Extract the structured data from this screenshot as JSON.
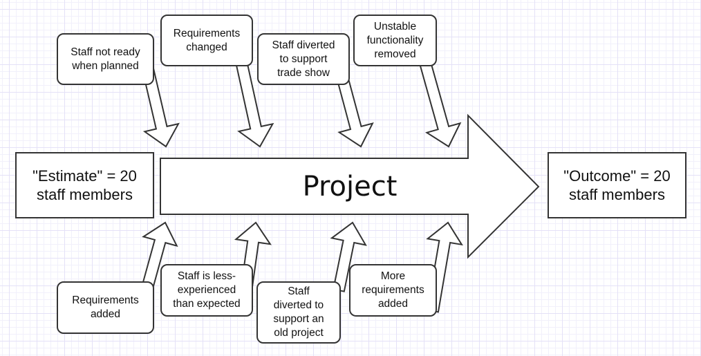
{
  "diagram": {
    "type": "cause-and-effect arrow diagram",
    "start": {
      "label": "\"Estimate\" = 20\nstaff members"
    },
    "main_arrow": {
      "label": "Project"
    },
    "end": {
      "label": "\"Outcome\" = 20\nstaff members"
    },
    "top_causes": [
      {
        "label": "Staff not ready\nwhen planned"
      },
      {
        "label": "Requirements\nchanged"
      },
      {
        "label": "Staff diverted\nto support\ntrade show"
      },
      {
        "label": "Unstable\nfunctionality\nremoved"
      }
    ],
    "bottom_causes": [
      {
        "label": "Requirements\nadded"
      },
      {
        "label": "Staff is less-\nexperienced\nthan expected"
      },
      {
        "label": "Staff\ndiverted to\nsupport an\nold project"
      },
      {
        "label": "More\nrequirements\nadded"
      }
    ]
  },
  "colors": {
    "stroke": "#333333",
    "fill": "#ffffff",
    "grid": "#e4e1f7",
    "text": "#111111"
  }
}
